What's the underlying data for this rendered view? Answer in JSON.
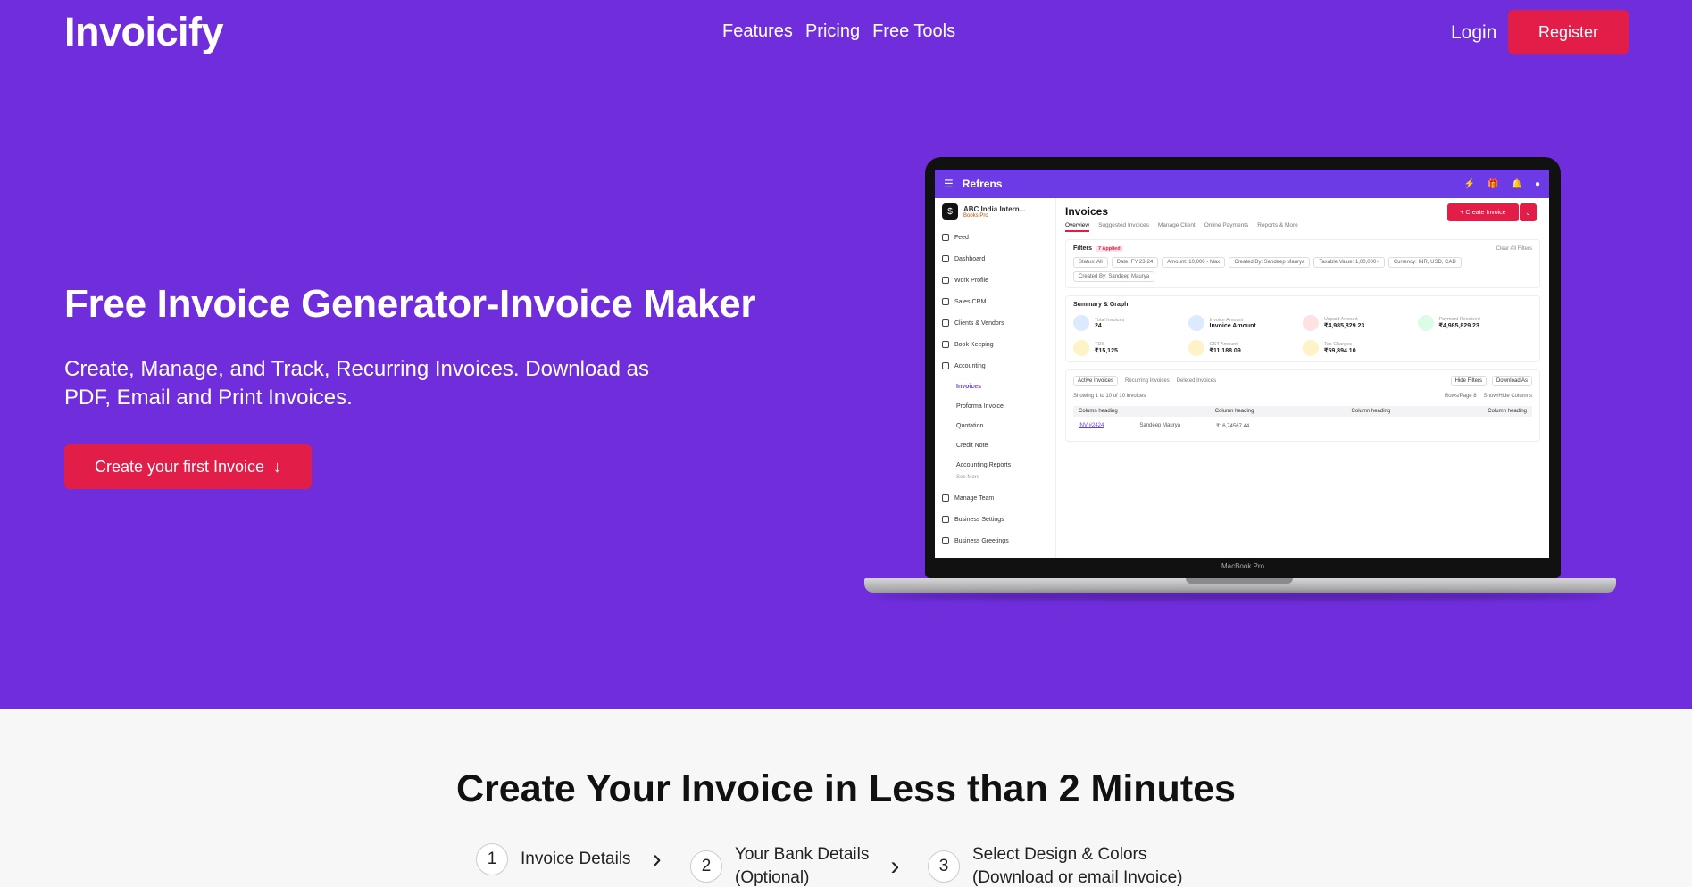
{
  "brand": "Invoicify",
  "nav": {
    "links": [
      "Features",
      "Pricing",
      "Free Tools"
    ],
    "login": "Login",
    "register": "Register"
  },
  "hero": {
    "title": "Free Invoice Generator-Invoice Maker",
    "subtitle": "Create, Manage, and Track, Recurring Invoices. Download as PDF, Email and Print Invoices.",
    "cta": "Create your first Invoice",
    "cta_icon": "↓"
  },
  "colors": {
    "hero_bg": "#6f2ddb",
    "accent": "#e11d48"
  },
  "app": {
    "brand": "Refrens",
    "org_name": "ABC India Intern...",
    "org_plan": "Books Pro",
    "sidebar": [
      "Feed",
      "Dashboard",
      "Work Profile",
      "Sales CRM",
      "Clients & Vendors",
      "Book Keeping",
      "Accounting"
    ],
    "accounting_sub": [
      "Invoices",
      "Proforma Invoice",
      "Quotation",
      "Credit Note",
      "Accounting Reports"
    ],
    "see_more": "See More",
    "sidebar_bottom": [
      "Manage Team",
      "Business Settings",
      "Business Greetings"
    ],
    "page_title": "Invoices",
    "tabs": [
      "Overview",
      "Suggested Invoices",
      "Manage Client",
      "Online Payments",
      "Reports & More"
    ],
    "create_btn": "+ Create Invoice",
    "filters_title": "Filters",
    "filters_tag": "7 Applied",
    "clear_filters": "Clear All Filters",
    "chips": [
      "Status: All",
      "Date: FY 23-24",
      "Amount: 10,000 - Max",
      "Created By: Sandeep Maurya",
      "Taxable Value: 1,00,000+",
      "Currency: INR, USD, CAD",
      "Created By: Sandeep Maurya"
    ],
    "summary_title": "Summary & Graph",
    "stats": [
      {
        "label": "Total Invoices",
        "value": "24",
        "color": "#dbeafe"
      },
      {
        "label": "Invoice Amount",
        "value": "Invoice Amount",
        "color": "#dbeafe"
      },
      {
        "label": "Unpaid Amount",
        "value": "₹4,985,829.23",
        "color": "#fee2e2"
      },
      {
        "label": "Payment Received",
        "value": "₹4,985,829.23",
        "color": "#dcfce7"
      },
      {
        "label": "TDS",
        "value": "₹15,125",
        "color": "#fef3c7"
      },
      {
        "label": "GST Amount",
        "value": "₹11,188.09",
        "color": "#fef3c7"
      },
      {
        "label": "Tax Charges",
        "value": "₹59,894.10",
        "color": "#fef3c7"
      }
    ],
    "table_tabs": [
      "Active Invoices",
      "Recurring Invoices",
      "Deleted Invoices"
    ],
    "hide_filters": "Hide Filters",
    "download_as": "Download As",
    "showing": "Showing 1 to 10 of 10 invoices",
    "rows_page": "Rows/Page 8",
    "show_hide_columns": "Show/Hide Columns",
    "column_heading": "Column heading",
    "row": {
      "invoice": "INV #2424",
      "name": "Sandeep Maurya",
      "amount": "₹16,74567.44"
    },
    "device": "MacBook Pro"
  },
  "steps": {
    "title": "Create Your Invoice in Less than 2 Minutes",
    "items": [
      {
        "num": "1",
        "line1": "Invoice Details",
        "line2": ""
      },
      {
        "num": "2",
        "line1": "Your Bank Details",
        "line2": "(Optional)"
      },
      {
        "num": "3",
        "line1": "Select Design & Colors",
        "line2": "(Download or email Invoice)"
      }
    ]
  }
}
